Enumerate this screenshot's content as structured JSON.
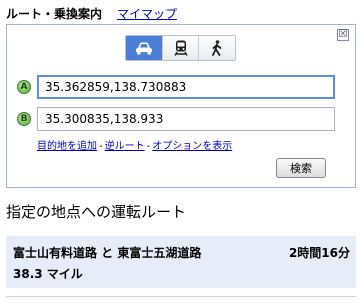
{
  "tabs": {
    "active_label": "ルート・乗換案内",
    "link_label": "マイマップ"
  },
  "panel": {
    "close_symbol": "☒",
    "modes": [
      {
        "name": "car-icon",
        "active": true
      },
      {
        "name": "train-icon",
        "active": false
      },
      {
        "name": "walking-icon",
        "active": false
      }
    ],
    "waypoint_a": {
      "marker": "A",
      "value": "35.362859,138.730883"
    },
    "waypoint_b": {
      "marker": "B",
      "value": "35.300835,138.933"
    },
    "links": {
      "add_destination": "目的地を追加",
      "reverse_route": "逆ルート",
      "show_options": "オプションを表示",
      "separator": "-"
    },
    "search_label": "検索"
  },
  "results": {
    "heading": "指定の地点への運転ルート",
    "route": {
      "name": "富士山有料道路 と 東富士五湖道路",
      "duration": "2時間16分",
      "distance": "38.3 マイル"
    }
  },
  "colors": {
    "accent": "#4c7ed7",
    "link": "#0000cc",
    "route_background": "#e6ecf8",
    "marker": "#5aa83a"
  }
}
